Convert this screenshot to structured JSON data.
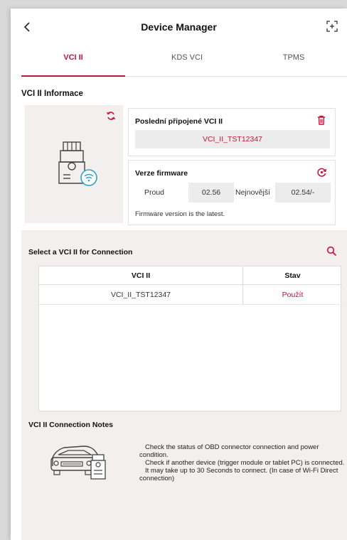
{
  "header": {
    "title": "Device Manager",
    "back_icon": "chevron-left-icon",
    "expand_icon": "expand-icon"
  },
  "tabs": [
    {
      "label": "VCI II",
      "active": true
    },
    {
      "label": "KDS VCI",
      "active": false
    },
    {
      "label": "TPMS",
      "active": false
    }
  ],
  "info": {
    "section_title": "VCI II Informace",
    "last_connected_title": "Poslední připojené VCI II",
    "last_connected_value": "VCI_II_TST12347",
    "firmware_title": "Verze firmware",
    "current_label": "Proud",
    "current_value": "02.56",
    "latest_label": "Nejnovější",
    "latest_value": "02.54/-",
    "firmware_note": "Firmware version is the latest."
  },
  "connection": {
    "title": "Select a VCI II for Connection",
    "columns": [
      "VCI II",
      "Stav"
    ],
    "rows": [
      {
        "vci": "VCI_II_TST12347",
        "status": "Použít"
      }
    ]
  },
  "notes": {
    "title": "VCI II Connection Notes",
    "lines": [
      "Check the status of OBD connector connection and power condition.",
      "Check if another device (trigger module or tablet PC) is connected.",
      "It may take up to 30 Seconds to connect. (In case of Wi-Fi Direct connection)"
    ]
  },
  "colors": {
    "accent": "#c4153a",
    "panel_bg": "#f3efee",
    "wifi": "#2aa6c9"
  }
}
